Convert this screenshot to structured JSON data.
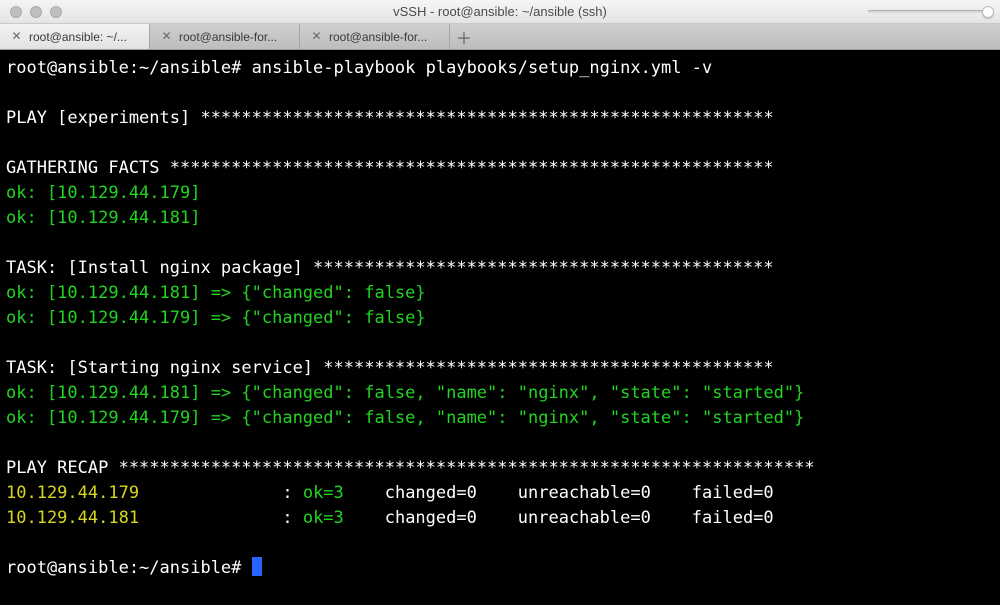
{
  "window": {
    "title": "vSSH - root@ansible: ~/ansible (ssh)"
  },
  "tabs": {
    "items": [
      {
        "label": "root@ansible: ~/...",
        "active": true
      },
      {
        "label": "root@ansible-for...",
        "active": false
      },
      {
        "label": "root@ansible-for...",
        "active": false
      }
    ]
  },
  "prompt": {
    "line1_prefix": "root@ansible:~/ansible# ",
    "line1_cmd": "ansible-playbook playbooks/setup_nginx.yml -v",
    "final_prefix": "root@ansible:~/ansible# "
  },
  "output": {
    "play_header": "PLAY [experiments] ******************************************************** ",
    "gather_header": "GATHERING FACTS *********************************************************** ",
    "gather_r1": "ok: [10.129.44.179]",
    "gather_r2": "ok: [10.129.44.181]",
    "task1_header": "TASK: [Install nginx package] ********************************************* ",
    "task1_r1": "ok: [10.129.44.181] => {\"changed\": false}",
    "task1_r2": "ok: [10.129.44.179] => {\"changed\": false}",
    "task2_header": "TASK: [Starting nginx service] ******************************************** ",
    "task2_r1": "ok: [10.129.44.181] => {\"changed\": false, \"name\": \"nginx\", \"state\": \"started\"}",
    "task2_r2": "ok: [10.129.44.179] => {\"changed\": false, \"name\": \"nginx\", \"state\": \"started\"}",
    "recap_header": "PLAY RECAP ******************************************************************** ",
    "recap1_host": "10.129.44.179",
    "recap1_sep": "              : ",
    "recap1_ok": "ok=3   ",
    "recap1_rest": " changed=0    unreachable=0    failed=0   ",
    "recap2_host": "10.129.44.181",
    "recap2_sep": "              : ",
    "recap2_ok": "ok=3   ",
    "recap2_rest": " changed=0    unreachable=0    failed=0   "
  }
}
